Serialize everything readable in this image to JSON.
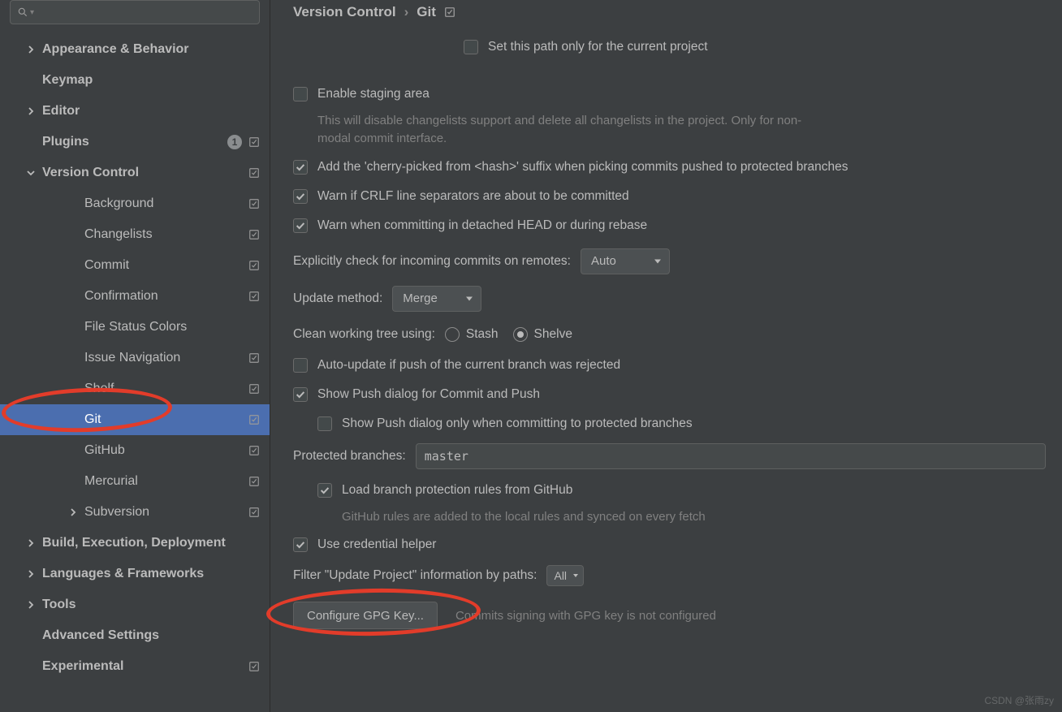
{
  "breadcrumb": {
    "parent": "Version Control",
    "current": "Git"
  },
  "sidebar": {
    "items": [
      {
        "label": "Appearance & Behavior",
        "arrow": "right",
        "bold": true
      },
      {
        "label": "Keymap",
        "bold": true
      },
      {
        "label": "Editor",
        "arrow": "right",
        "bold": true
      },
      {
        "label": "Plugins",
        "bold": true,
        "badge": "1",
        "reset": true
      },
      {
        "label": "Version Control",
        "arrow": "down",
        "bold": true,
        "reset": true
      },
      {
        "label": "Background",
        "indent": 2,
        "reset": true
      },
      {
        "label": "Changelists",
        "indent": 2,
        "reset": true
      },
      {
        "label": "Commit",
        "indent": 2,
        "reset": true
      },
      {
        "label": "Confirmation",
        "indent": 2,
        "reset": true
      },
      {
        "label": "File Status Colors",
        "indent": 2
      },
      {
        "label": "Issue Navigation",
        "indent": 2,
        "reset": true
      },
      {
        "label": "Shelf",
        "indent": 2,
        "reset": true
      },
      {
        "label": "Git",
        "indent": 2,
        "reset": true,
        "selected": true
      },
      {
        "label": "GitHub",
        "indent": 2,
        "reset": true
      },
      {
        "label": "Mercurial",
        "indent": 2,
        "reset": true
      },
      {
        "label": "Subversion",
        "indent": 2,
        "arrow": "right",
        "reset": true
      },
      {
        "label": "Build, Execution, Deployment",
        "arrow": "right",
        "bold": true
      },
      {
        "label": "Languages & Frameworks",
        "arrow": "right",
        "bold": true
      },
      {
        "label": "Tools",
        "arrow": "right",
        "bold": true
      },
      {
        "label": "Advanced Settings",
        "bold": true
      },
      {
        "label": "Experimental",
        "bold": true,
        "reset": true
      }
    ]
  },
  "settings": {
    "path_current_project": {
      "label": "Set this path only for the current project",
      "checked": false
    },
    "enable_staging": {
      "label": "Enable staging area",
      "checked": false,
      "desc": "This will disable changelists support and delete all changelists in the project. Only for non-modal commit interface."
    },
    "cherry_suffix": {
      "label": "Add the 'cherry-picked from <hash>' suffix when picking commits pushed to protected branches",
      "checked": true
    },
    "warn_crlf": {
      "label": "Warn if CRLF line separators are about to be committed",
      "checked": true
    },
    "warn_detached": {
      "label": "Warn when committing in detached HEAD or during rebase",
      "checked": true
    },
    "explicit_label": "Explicitly check for incoming commits on remotes:",
    "explicit_value": "Auto",
    "update_label": "Update method:",
    "update_value": "Merge",
    "clean_label": "Clean working tree using:",
    "clean_stash": "Stash",
    "clean_shelve": "Shelve",
    "auto_update": {
      "label": "Auto-update if push of the current branch was rejected",
      "checked": false
    },
    "show_push": {
      "label": "Show Push dialog for Commit and Push",
      "checked": true
    },
    "show_push_protected": {
      "label": "Show Push dialog only when committing to protected branches",
      "checked": false
    },
    "protected_label": "Protected branches:",
    "protected_value": "master",
    "load_rules": {
      "label": "Load branch protection rules from GitHub",
      "checked": true,
      "desc": "GitHub rules are added to the local rules and synced on every fetch"
    },
    "use_cred": {
      "label": "Use credential helper",
      "checked": true
    },
    "filter_label": "Filter \"Update Project\" information by paths:",
    "filter_value": "All",
    "gpg_btn": "Configure GPG Key...",
    "gpg_note": "Commits signing with GPG key is not configured"
  },
  "watermark": "CSDN @张雨zy"
}
